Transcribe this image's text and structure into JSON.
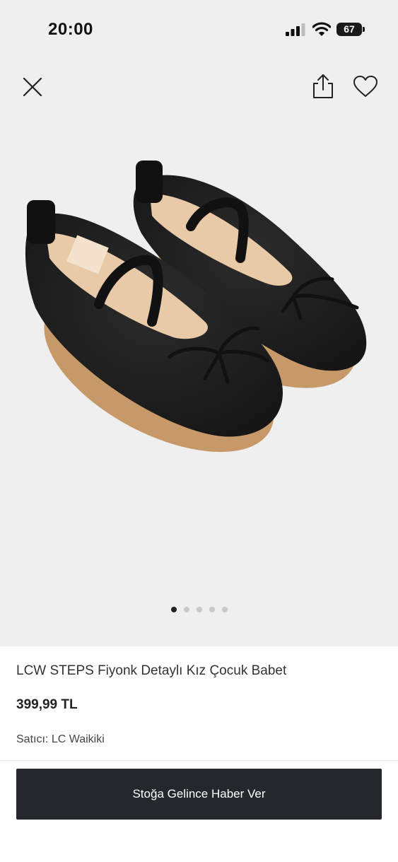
{
  "status_bar": {
    "time": "20:00",
    "battery_level": "67",
    "icons": [
      "signal-icon",
      "wifi-icon",
      "battery-icon"
    ]
  },
  "toolbar": {
    "icons": [
      "close-icon",
      "share-icon",
      "heart-icon"
    ]
  },
  "gallery": {
    "image_count": 5,
    "active_index": 0,
    "background_color": "#efefef"
  },
  "product": {
    "title": "LCW STEPS Fiyonk Detaylı Kız Çocuk Babet",
    "price": "399,99 TL",
    "seller_label": "Satıcı:",
    "seller_name": "LC Waikiki"
  },
  "cta": {
    "label": "Stoğa Gelince Haber Ver",
    "color": "#24272b"
  }
}
